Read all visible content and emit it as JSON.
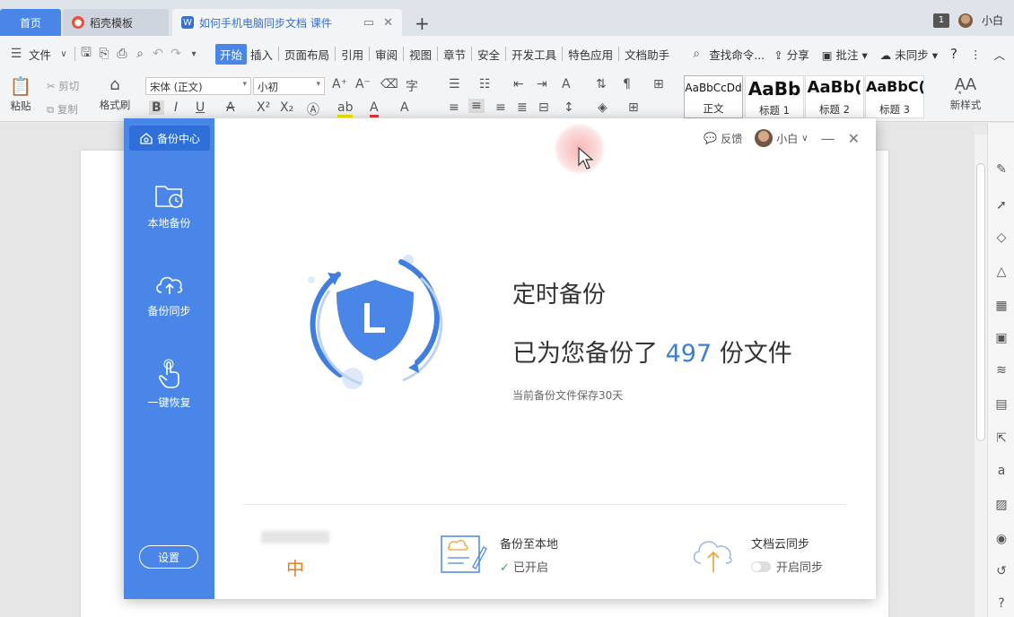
{
  "tabs": [
    {
      "label": "首页"
    },
    {
      "label": "稻壳模板"
    },
    {
      "label": "如何手机电脑同步文档 课件"
    }
  ],
  "window": {
    "badge": "1",
    "user": "小白"
  },
  "menubar": {
    "file": "文件",
    "items": [
      "开始",
      "插入",
      "页面布局",
      "引用",
      "审阅",
      "视图",
      "章节",
      "安全",
      "开发工具",
      "特色应用",
      "文档助手"
    ],
    "search": "查找命令...",
    "share": "分享",
    "comment": "批注",
    "sync": "未同步",
    "help": "?"
  },
  "ribbon": {
    "paste": "粘贴",
    "cut": "剪切",
    "copy": "复制",
    "format_painter": "格式刷",
    "font_name": "宋体 (正文)",
    "font_size": "小初",
    "styles": [
      {
        "sample": "AaBbCcDd",
        "label": "正文"
      },
      {
        "sample": "AaBb",
        "label": "标题 1"
      },
      {
        "sample": "AaBb(",
        "label": "标题 2"
      },
      {
        "sample": "AaBbC(",
        "label": "标题 3"
      }
    ],
    "new_style": "新样式"
  },
  "dialog": {
    "brand": "备份中心",
    "nav": [
      {
        "label": "本地备份",
        "icon": "folder-clock-icon"
      },
      {
        "label": "备份同步",
        "icon": "cloud-upload-icon"
      },
      {
        "label": "一键恢复",
        "icon": "hand-pointer-icon"
      }
    ],
    "settings": "设置",
    "feedback": "反馈",
    "user": "小白",
    "title": "定时备份",
    "count_prefix": "已为您备份了",
    "count": "497",
    "count_suffix": "份文件",
    "subtitle": "当前备份文件保存30天",
    "footer": {
      "mid_char": "中",
      "local_title": "备份至本地",
      "local_status": "已开启",
      "cloud_title": "文档云同步",
      "cloud_status": "开启同步"
    },
    "colors": {
      "sidebar": "#4a86e8",
      "accent": "#3a7fd5",
      "mid": "#e67e22",
      "check": "#3aa55b"
    }
  }
}
